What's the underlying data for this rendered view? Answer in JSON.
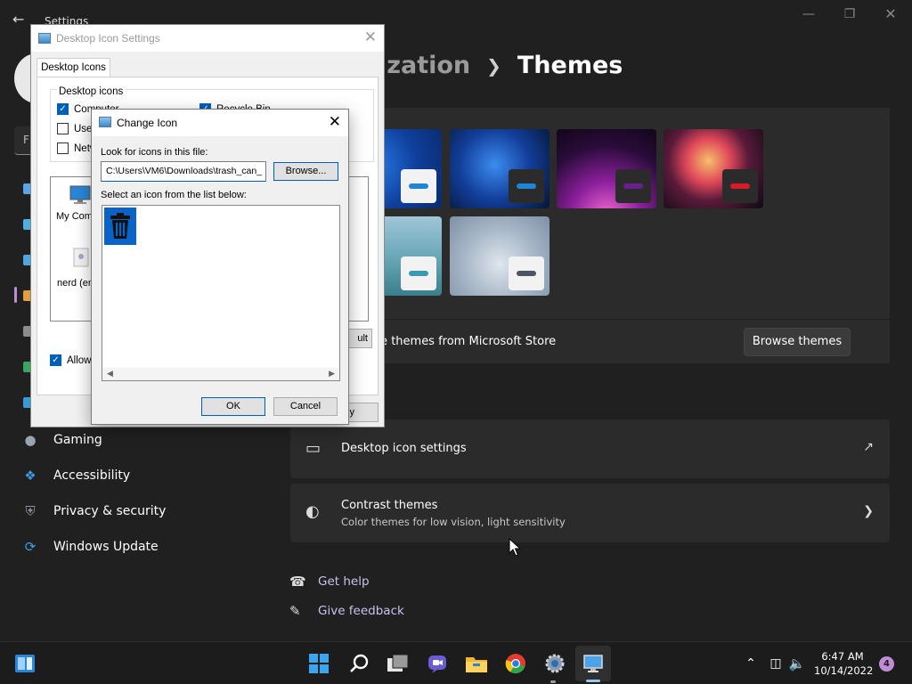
{
  "settings": {
    "app_title": "Settings",
    "find_placeholder": "F",
    "breadcrumb": {
      "parent": "ization",
      "current": "Themes"
    },
    "nav": [
      {
        "label": "Gaming",
        "icon": "gamepad-icon"
      },
      {
        "label": "Accessibility",
        "icon": "accessibility-icon"
      },
      {
        "label": "Privacy & security",
        "icon": "shield-icon"
      },
      {
        "label": "Windows Update",
        "icon": "windows-update-icon"
      }
    ],
    "store_text": "re themes from Microsoft Store",
    "browse_themes_label": "Browse themes",
    "related": {
      "desktop_icon_settings": "Desktop icon settings",
      "contrast_title": "Contrast themes",
      "contrast_sub": "Color themes for low vision, light sensitivity"
    },
    "help": {
      "get_help": "Get help",
      "give_feedback": "Give feedback"
    },
    "theme_swatch_colors": [
      "#1f86d6",
      "#1f86d6",
      "#6b1f8c",
      "#d81a2a",
      "#3a9ab5",
      "#4a5663"
    ]
  },
  "desktop_icon_dialog": {
    "title": "Desktop Icon Settings",
    "tab": "Desktop Icons",
    "group_label": "Desktop icons",
    "checkboxes": [
      {
        "label": "Computer",
        "checked": true
      },
      {
        "label": "User",
        "checked": false
      },
      {
        "label": "Netw",
        "checked": false
      },
      {
        "label": "Recycle Bin",
        "checked": true
      }
    ],
    "icon_labels": [
      "My Comp",
      "nerd (em"
    ],
    "restore_label": "ult",
    "allow_label": "Allow t",
    "apply_label": "ly"
  },
  "change_icon_dialog": {
    "title": "Change Icon",
    "look_label": "Look for icons in this file:",
    "path_value": "C:\\Users\\VM6\\Downloads\\trash_can_",
    "browse_label": "Browse...",
    "select_label": "Select an icon from the list below:",
    "ok_label": "OK",
    "cancel_label": "Cancel"
  },
  "taskbar": {
    "time": "6:47 AM",
    "date": "10/14/2022",
    "notification_count": "4",
    "pinned": [
      "windows-start-icon",
      "search-icon",
      "task-view-icon",
      "teams-chat-icon",
      "file-explorer-icon",
      "chrome-icon",
      "settings-gear-icon",
      "desktop-icon-settings-app-icon"
    ]
  },
  "colors": {
    "accent": "#c08cd6",
    "dialog_blue": "#005fb8"
  }
}
